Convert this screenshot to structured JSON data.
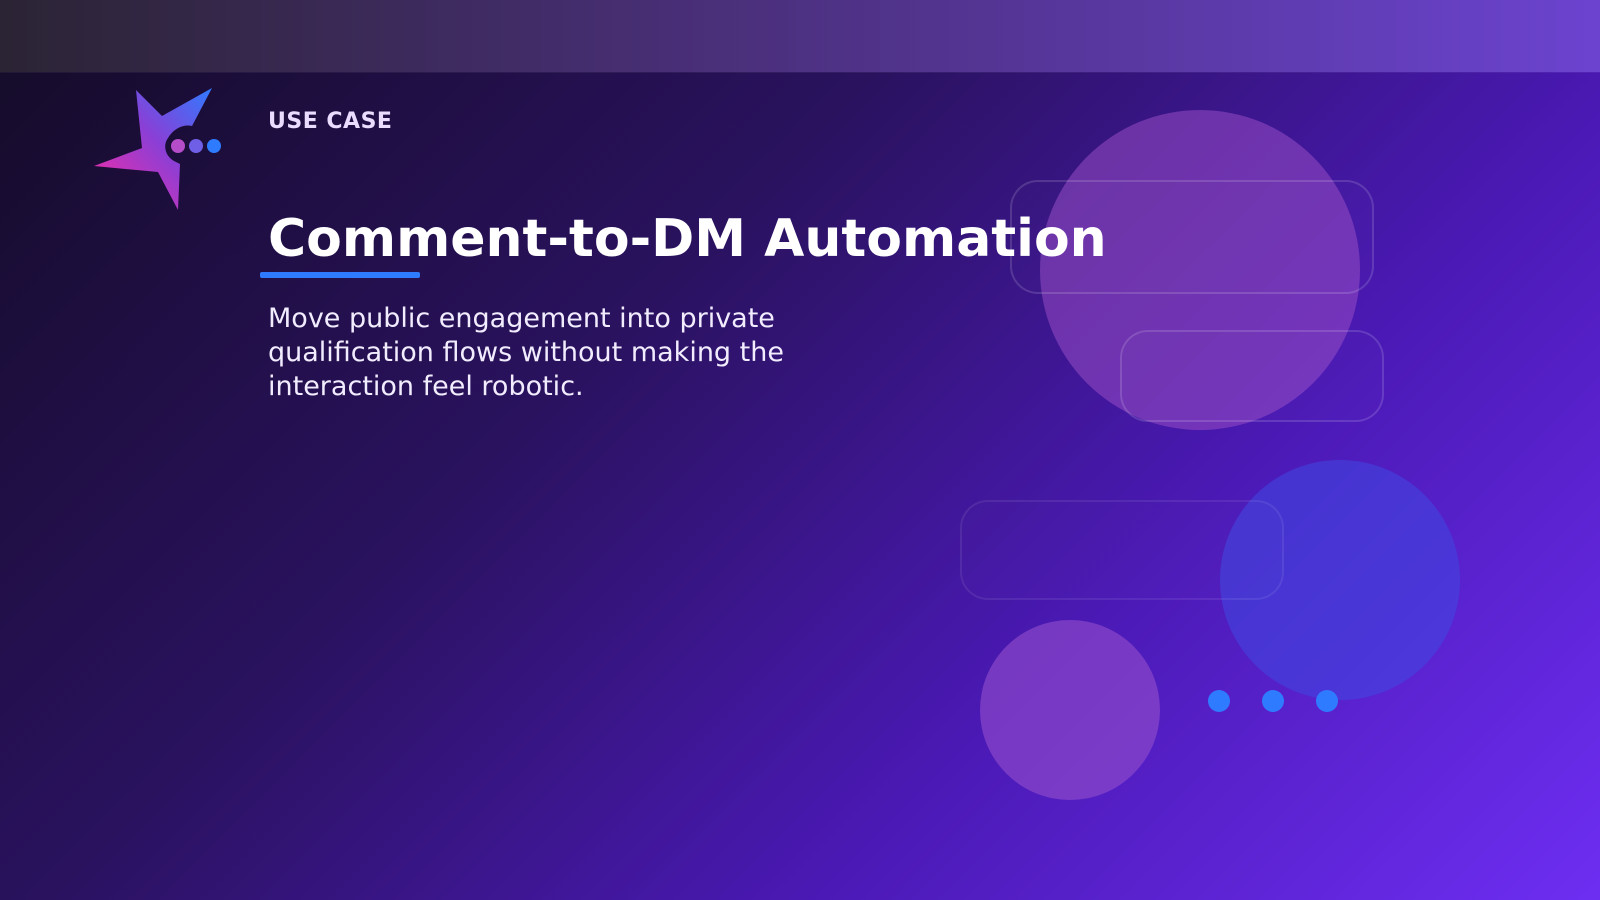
{
  "theme": {
    "background_colors": [
      "#140b26",
      "#2a125f",
      "#4a19b4",
      "#6e2ef2"
    ],
    "accent": "#2f7bff",
    "eyebrow_color": "#e9dcff",
    "text_color": "#ffffff"
  },
  "slide": {
    "eyebrow": "USE CASE",
    "title": "Comment-to-DM Automation",
    "subtitle": "Move public engagement into private qualification flows without making the interaction feel robotic."
  },
  "logo": {
    "icon": "star-chat-logo-icon"
  },
  "decorations": {
    "icons": [
      "decorative-bubble-icon",
      "decorative-chat-pill-icon",
      "typing-dots-icon"
    ]
  }
}
